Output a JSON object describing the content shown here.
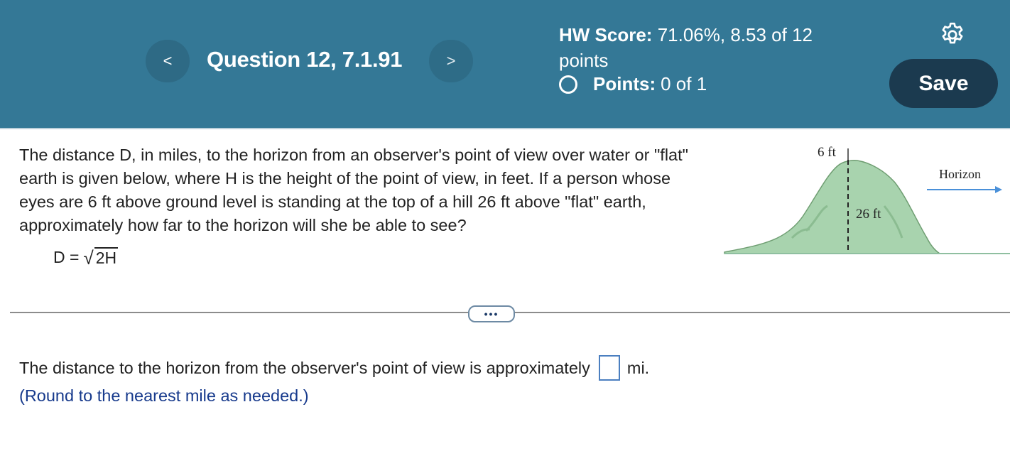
{
  "header": {
    "prev_icon": "chevron-left-icon",
    "prev_glyph": "<",
    "next_icon": "chevron-right-icon",
    "next_glyph": ">",
    "question_title": "Question 12, 7.1.91",
    "hw_score_label": "HW Score:",
    "hw_score_value": "71.06%, 8.53 of 12",
    "hw_score_unit": "points",
    "points_label": "Points:",
    "points_value": "0 of 1",
    "settings_icon": "gear-icon",
    "save_label": "Save",
    "colors": {
      "header_bg": "#347896",
      "save_bg": "#1b3a4f"
    }
  },
  "question": {
    "text": "The distance D, in miles, to the horizon from an observer's point of view over water or \"flat\" earth is given below, where H is the height of the point of view, in feet. If a person whose eyes are 6 ft above ground level is standing at the top of a hill 26 ft above \"flat\" earth, approximately how far to the horizon will she be able to see?",
    "formula_lhs": "D =",
    "formula_radicand": "2H",
    "figure": {
      "eye_height_label": "6 ft",
      "hill_height_label": "26 ft",
      "horizon_label": "Horizon"
    }
  },
  "more_button": {
    "label": "•••"
  },
  "answer": {
    "prefix": "The distance to the horizon from the observer's point of view is approximately",
    "unit": "mi.",
    "value": "",
    "hint": "(Round to the nearest mile as needed.)"
  }
}
